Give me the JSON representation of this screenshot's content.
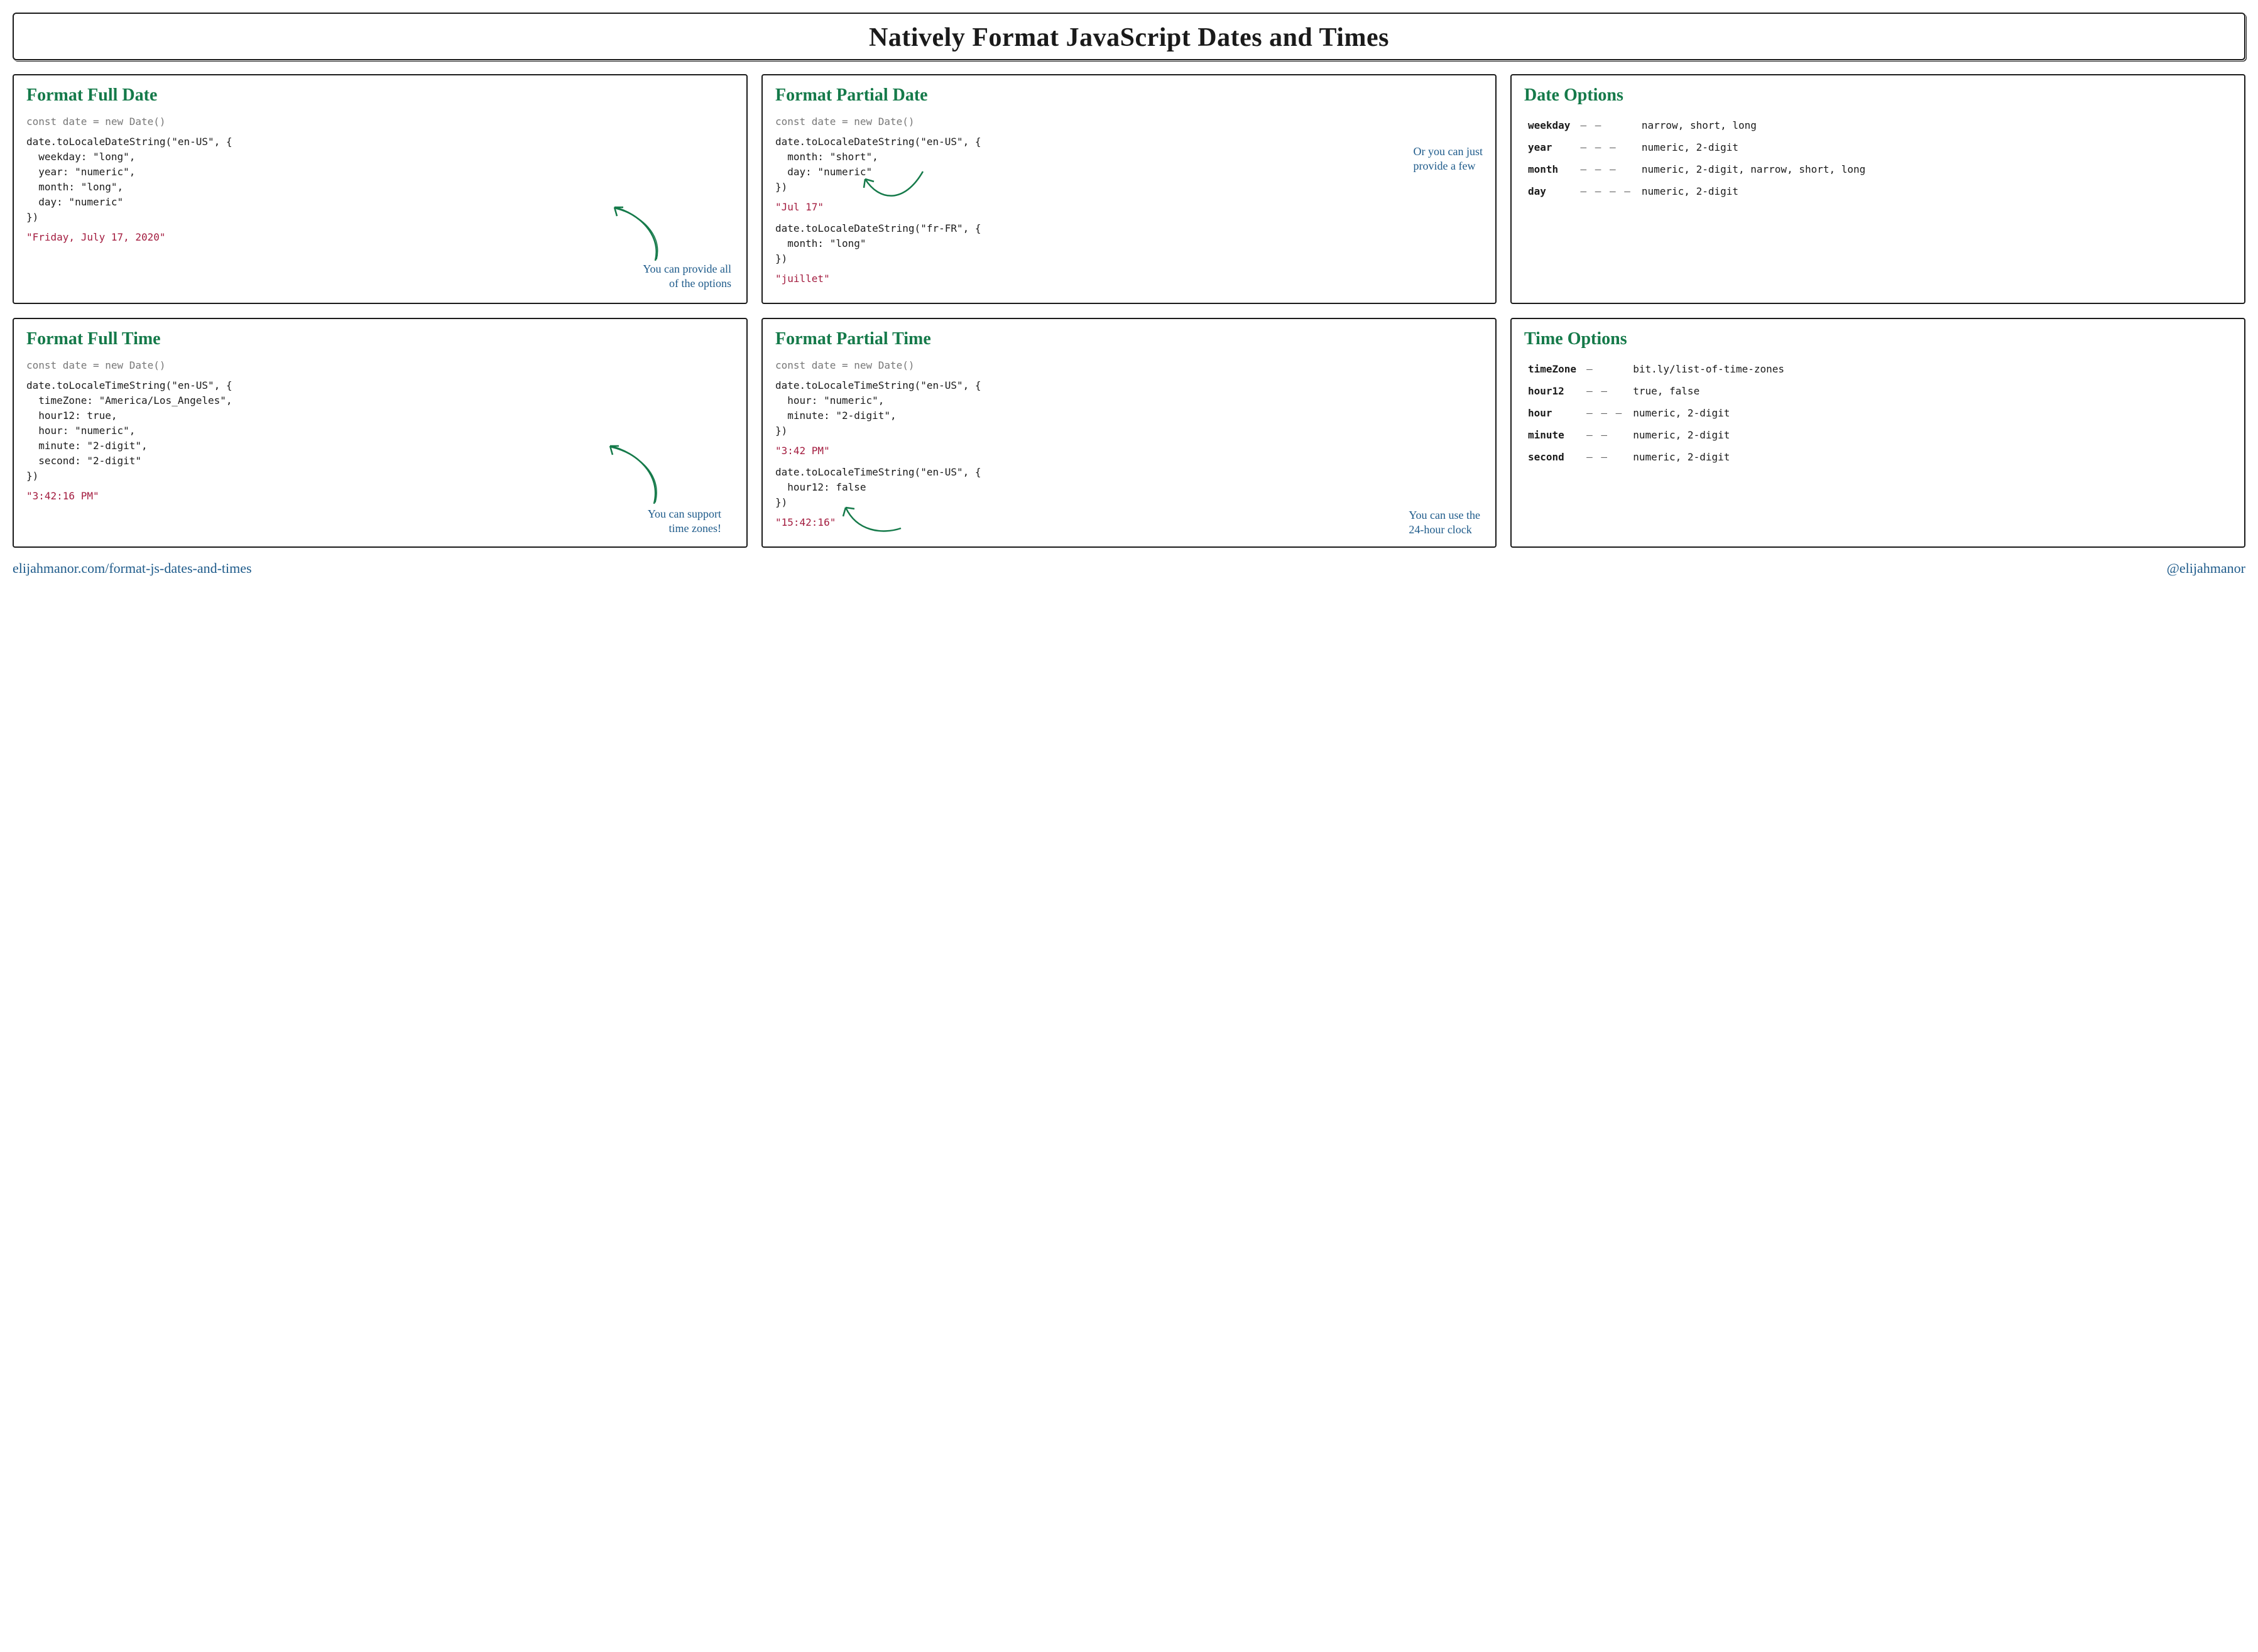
{
  "title": "Natively Format JavaScript Dates and Times",
  "card_full_date": {
    "heading": "Format Full Date",
    "const_line": "const date = new Date()",
    "code": "date.toLocaleDateString(\"en-US\", {\n  weekday: \"long\",\n  year: \"numeric\",\n  month: \"long\",\n  day: \"numeric\"\n})",
    "result": "\"Friday, July 17, 2020\"",
    "annotation": "You can provide all\nof the options"
  },
  "card_partial_date": {
    "heading": "Format Partial Date",
    "const_line": "const date = new Date()",
    "code1": "date.toLocaleDateString(\"en-US\", {\n  month: \"short\",\n  day: \"numeric\"\n})",
    "result1": "\"Jul 17\"",
    "code2": "date.toLocaleDateString(\"fr-FR\", {\n  month: \"long\"\n})",
    "result2": "\"juillet\"",
    "annotation": "Or you can just\nprovide a few"
  },
  "card_date_options": {
    "heading": "Date Options",
    "rows": [
      {
        "key": "weekday",
        "dash": "— —",
        "vals": "narrow, short, long"
      },
      {
        "key": "year",
        "dash": "— — —",
        "vals": "numeric, 2-digit"
      },
      {
        "key": "month",
        "dash": "— — —",
        "vals": "numeric, 2-digit, narrow, short, long"
      },
      {
        "key": "day",
        "dash": "— — — —",
        "vals": "numeric, 2-digit"
      }
    ]
  },
  "card_full_time": {
    "heading": "Format Full Time",
    "const_line": "const date = new Date()",
    "code": "date.toLocaleTimeString(\"en-US\", {\n  timeZone: \"America/Los_Angeles\",\n  hour12: true,\n  hour: \"numeric\",\n  minute: \"2-digit\",\n  second: \"2-digit\"\n})",
    "result": "\"3:42:16 PM\"",
    "annotation": "You can support\ntime zones!"
  },
  "card_partial_time": {
    "heading": "Format Partial Time",
    "const_line": "const date = new Date()",
    "code1": "date.toLocaleTimeString(\"en-US\", {\n  hour: \"numeric\",\n  minute: \"2-digit\",\n})",
    "result1": "\"3:42 PM\"",
    "code2": "date.toLocaleTimeString(\"en-US\", {\n  hour12: false\n})",
    "result2": "\"15:42:16\"",
    "annotation": "You can use the\n24-hour clock"
  },
  "card_time_options": {
    "heading": "Time Options",
    "rows": [
      {
        "key": "timeZone",
        "dash": "—",
        "vals": "bit.ly/list-of-time-zones"
      },
      {
        "key": "hour12",
        "dash": "— —",
        "vals": "true, false"
      },
      {
        "key": "hour",
        "dash": "— — —",
        "vals": "numeric, 2-digit"
      },
      {
        "key": "minute",
        "dash": "— —",
        "vals": "numeric, 2-digit"
      },
      {
        "key": "second",
        "dash": "— —",
        "vals": "numeric, 2-digit"
      }
    ]
  },
  "footer": {
    "url": "elijahmanor.com/format-js-dates-and-times",
    "handle": "@elijahmanor"
  }
}
